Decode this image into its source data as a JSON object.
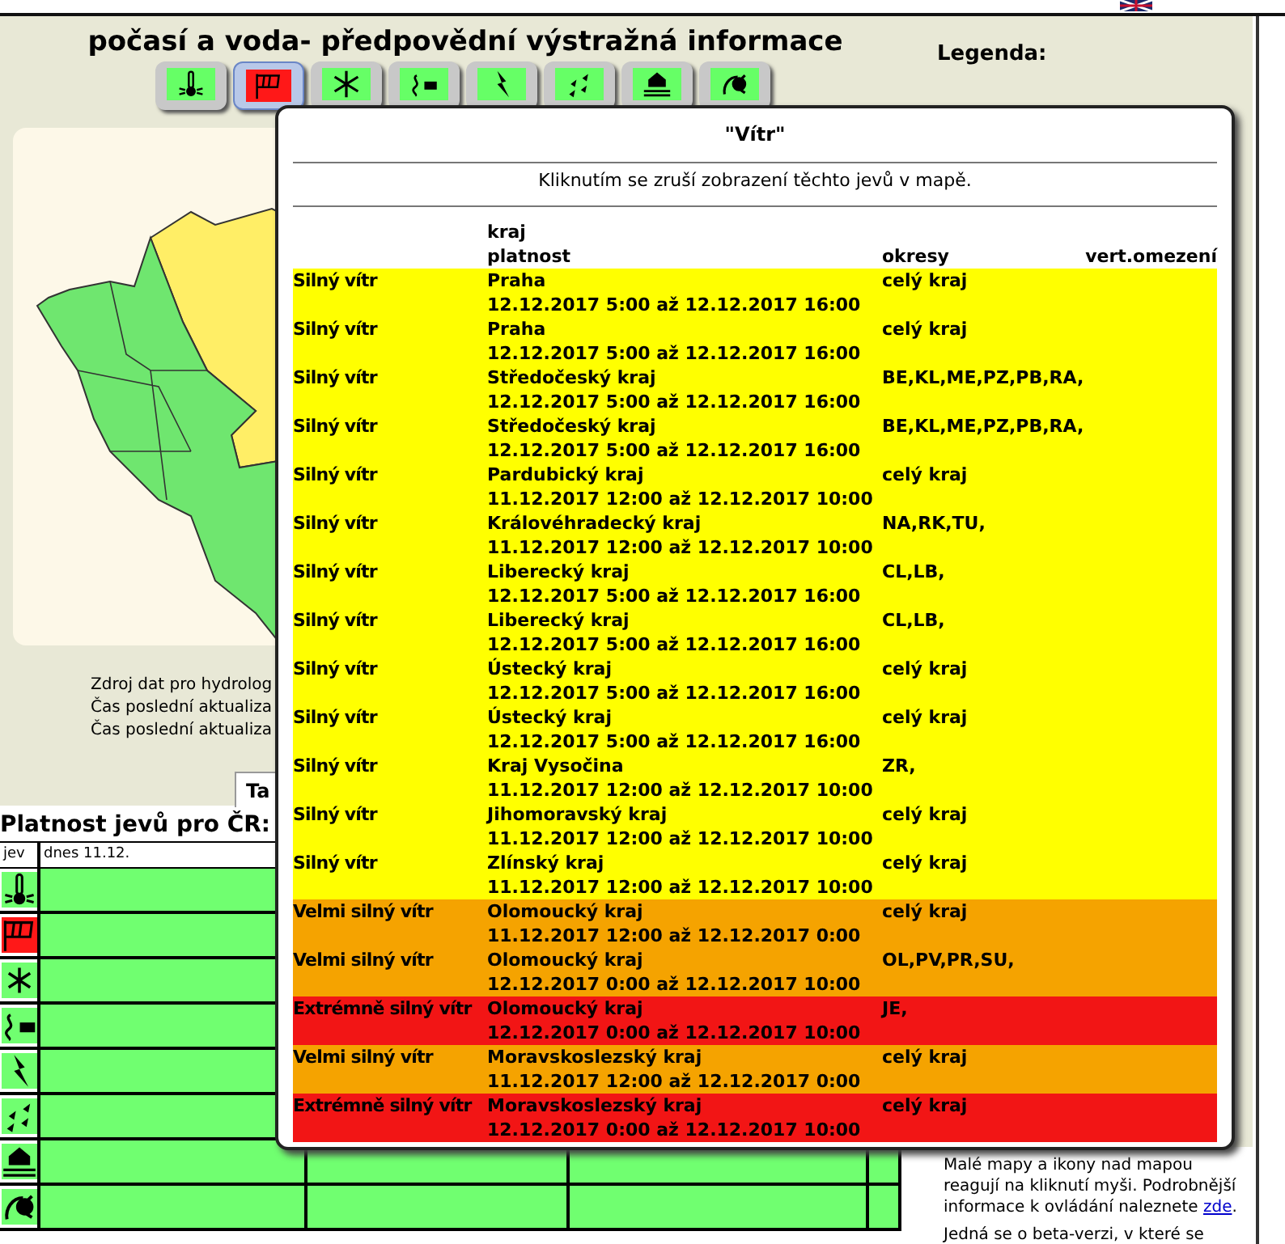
{
  "header": {
    "title": "počasí a voda- předpovědní výstražná informace"
  },
  "phenomena": [
    {
      "kind": "thermometer",
      "selected": false,
      "warning": false
    },
    {
      "kind": "windsock",
      "selected": true,
      "warning": true
    },
    {
      "kind": "snowflake",
      "selected": false,
      "warning": false
    },
    {
      "kind": "road",
      "selected": false,
      "warning": false
    },
    {
      "kind": "lightning",
      "selected": false,
      "warning": false
    },
    {
      "kind": "rain",
      "selected": false,
      "warning": false
    },
    {
      "kind": "flood",
      "selected": false,
      "warning": false
    },
    {
      "kind": "storm",
      "selected": false,
      "warning": false
    }
  ],
  "source_lines": [
    "Zdroj dat pro hydrolog",
    "Čas poslední aktualiza",
    "Čas poslední aktualiza"
  ],
  "tabs": [
    {
      "label": "Ta"
    }
  ],
  "validity": {
    "title": "Platnost jevů pro ČR:",
    "columns": [
      "jev",
      "dnes 11.12."
    ]
  },
  "legend": {
    "title": "Legenda:"
  },
  "help": {
    "text": "Malé mapy a ikony nad mapou reagují na kliknutí myši. Podrobnější informace k ovládání naleznete",
    "link": "zde",
    "end": ".",
    "beta": "Jedná se o beta-verzi, v které se"
  },
  "popup": {
    "title": "\"Vítr\"",
    "subtitle": "Kliknutím se zruší zobrazení těchto jevů v mapě.",
    "columns": [
      "",
      "kraj\nplatnost",
      "okresy",
      "vert.omezení"
    ],
    "rows": [
      {
        "type": "Silný vítr",
        "region": "Praha",
        "validity": "12.12.2017 5:00 až 12.12.2017 16:00",
        "districts": "celý kraj",
        "color": "#ffff00"
      },
      {
        "type": "Silný vítr",
        "region": "Praha",
        "validity": "12.12.2017 5:00 až 12.12.2017 16:00",
        "districts": "celý kraj",
        "color": "#ffff00"
      },
      {
        "type": "Silný vítr",
        "region": "Středočeský kraj",
        "validity": "12.12.2017 5:00 až 12.12.2017 16:00",
        "districts": "BE,KL,ME,PZ,PB,RA,",
        "color": "#ffff00"
      },
      {
        "type": "Silný vítr",
        "region": "Středočeský kraj",
        "validity": "12.12.2017 5:00 až 12.12.2017 16:00",
        "districts": "BE,KL,ME,PZ,PB,RA,",
        "color": "#ffff00"
      },
      {
        "type": "Silný vítr",
        "region": "Pardubický kraj",
        "validity": "11.12.2017 12:00 až 12.12.2017 10:00",
        "districts": "celý kraj",
        "color": "#ffff00"
      },
      {
        "type": "Silný vítr",
        "region": "Královéhradecký kraj",
        "validity": "11.12.2017 12:00 až 12.12.2017 10:00",
        "districts": "NA,RK,TU,",
        "color": "#ffff00"
      },
      {
        "type": "Silný vítr",
        "region": "Liberecký kraj",
        "validity": "12.12.2017 5:00 až 12.12.2017 16:00",
        "districts": "CL,LB,",
        "color": "#ffff00"
      },
      {
        "type": "Silný vítr",
        "region": "Liberecký kraj",
        "validity": "12.12.2017 5:00 až 12.12.2017 16:00",
        "districts": "CL,LB,",
        "color": "#ffff00"
      },
      {
        "type": "Silný vítr",
        "region": "Ústecký kraj",
        "validity": "12.12.2017 5:00 až 12.12.2017 16:00",
        "districts": "celý kraj",
        "color": "#ffff00"
      },
      {
        "type": "Silný vítr",
        "region": "Ústecký kraj",
        "validity": "12.12.2017 5:00 až 12.12.2017 16:00",
        "districts": "celý kraj",
        "color": "#ffff00"
      },
      {
        "type": "Silný vítr",
        "region": "Kraj Vysočina",
        "validity": "11.12.2017 12:00 až 12.12.2017 10:00",
        "districts": "ZR,",
        "color": "#ffff00"
      },
      {
        "type": "Silný vítr",
        "region": "Jihomoravský kraj",
        "validity": "11.12.2017 12:00 až 12.12.2017 10:00",
        "districts": "celý kraj",
        "color": "#ffff00"
      },
      {
        "type": "Silný vítr",
        "region": "Zlínský kraj",
        "validity": "11.12.2017 12:00 až 12.12.2017 10:00",
        "districts": "celý kraj",
        "color": "#ffff00"
      },
      {
        "type": "Velmi silný vítr",
        "region": "Olomoucký kraj",
        "validity": "11.12.2017 12:00 až 12.12.2017 0:00",
        "districts": "celý kraj",
        "color": "#f5a300"
      },
      {
        "type": "Velmi silný vítr",
        "region": "Olomoucký kraj",
        "validity": "12.12.2017 0:00 až 12.12.2017 10:00",
        "districts": "OL,PV,PR,SU,",
        "color": "#f5a300"
      },
      {
        "type": "Extrémně silný vítr",
        "region": "Olomoucký kraj",
        "validity": "12.12.2017 0:00 až 12.12.2017 10:00",
        "districts": "JE,",
        "color": "#f21515"
      },
      {
        "type": "Velmi silný vítr",
        "region": "Moravskoslezský kraj",
        "validity": "11.12.2017 12:00 až 12.12.2017 0:00",
        "districts": "celý kraj",
        "color": "#f5a300"
      },
      {
        "type": "Extrémně silný vítr",
        "region": "Moravskoslezský kraj",
        "validity": "12.12.2017 0:00 až 12.12.2017 10:00",
        "districts": "celý kraj",
        "color": "#f21515"
      }
    ]
  }
}
